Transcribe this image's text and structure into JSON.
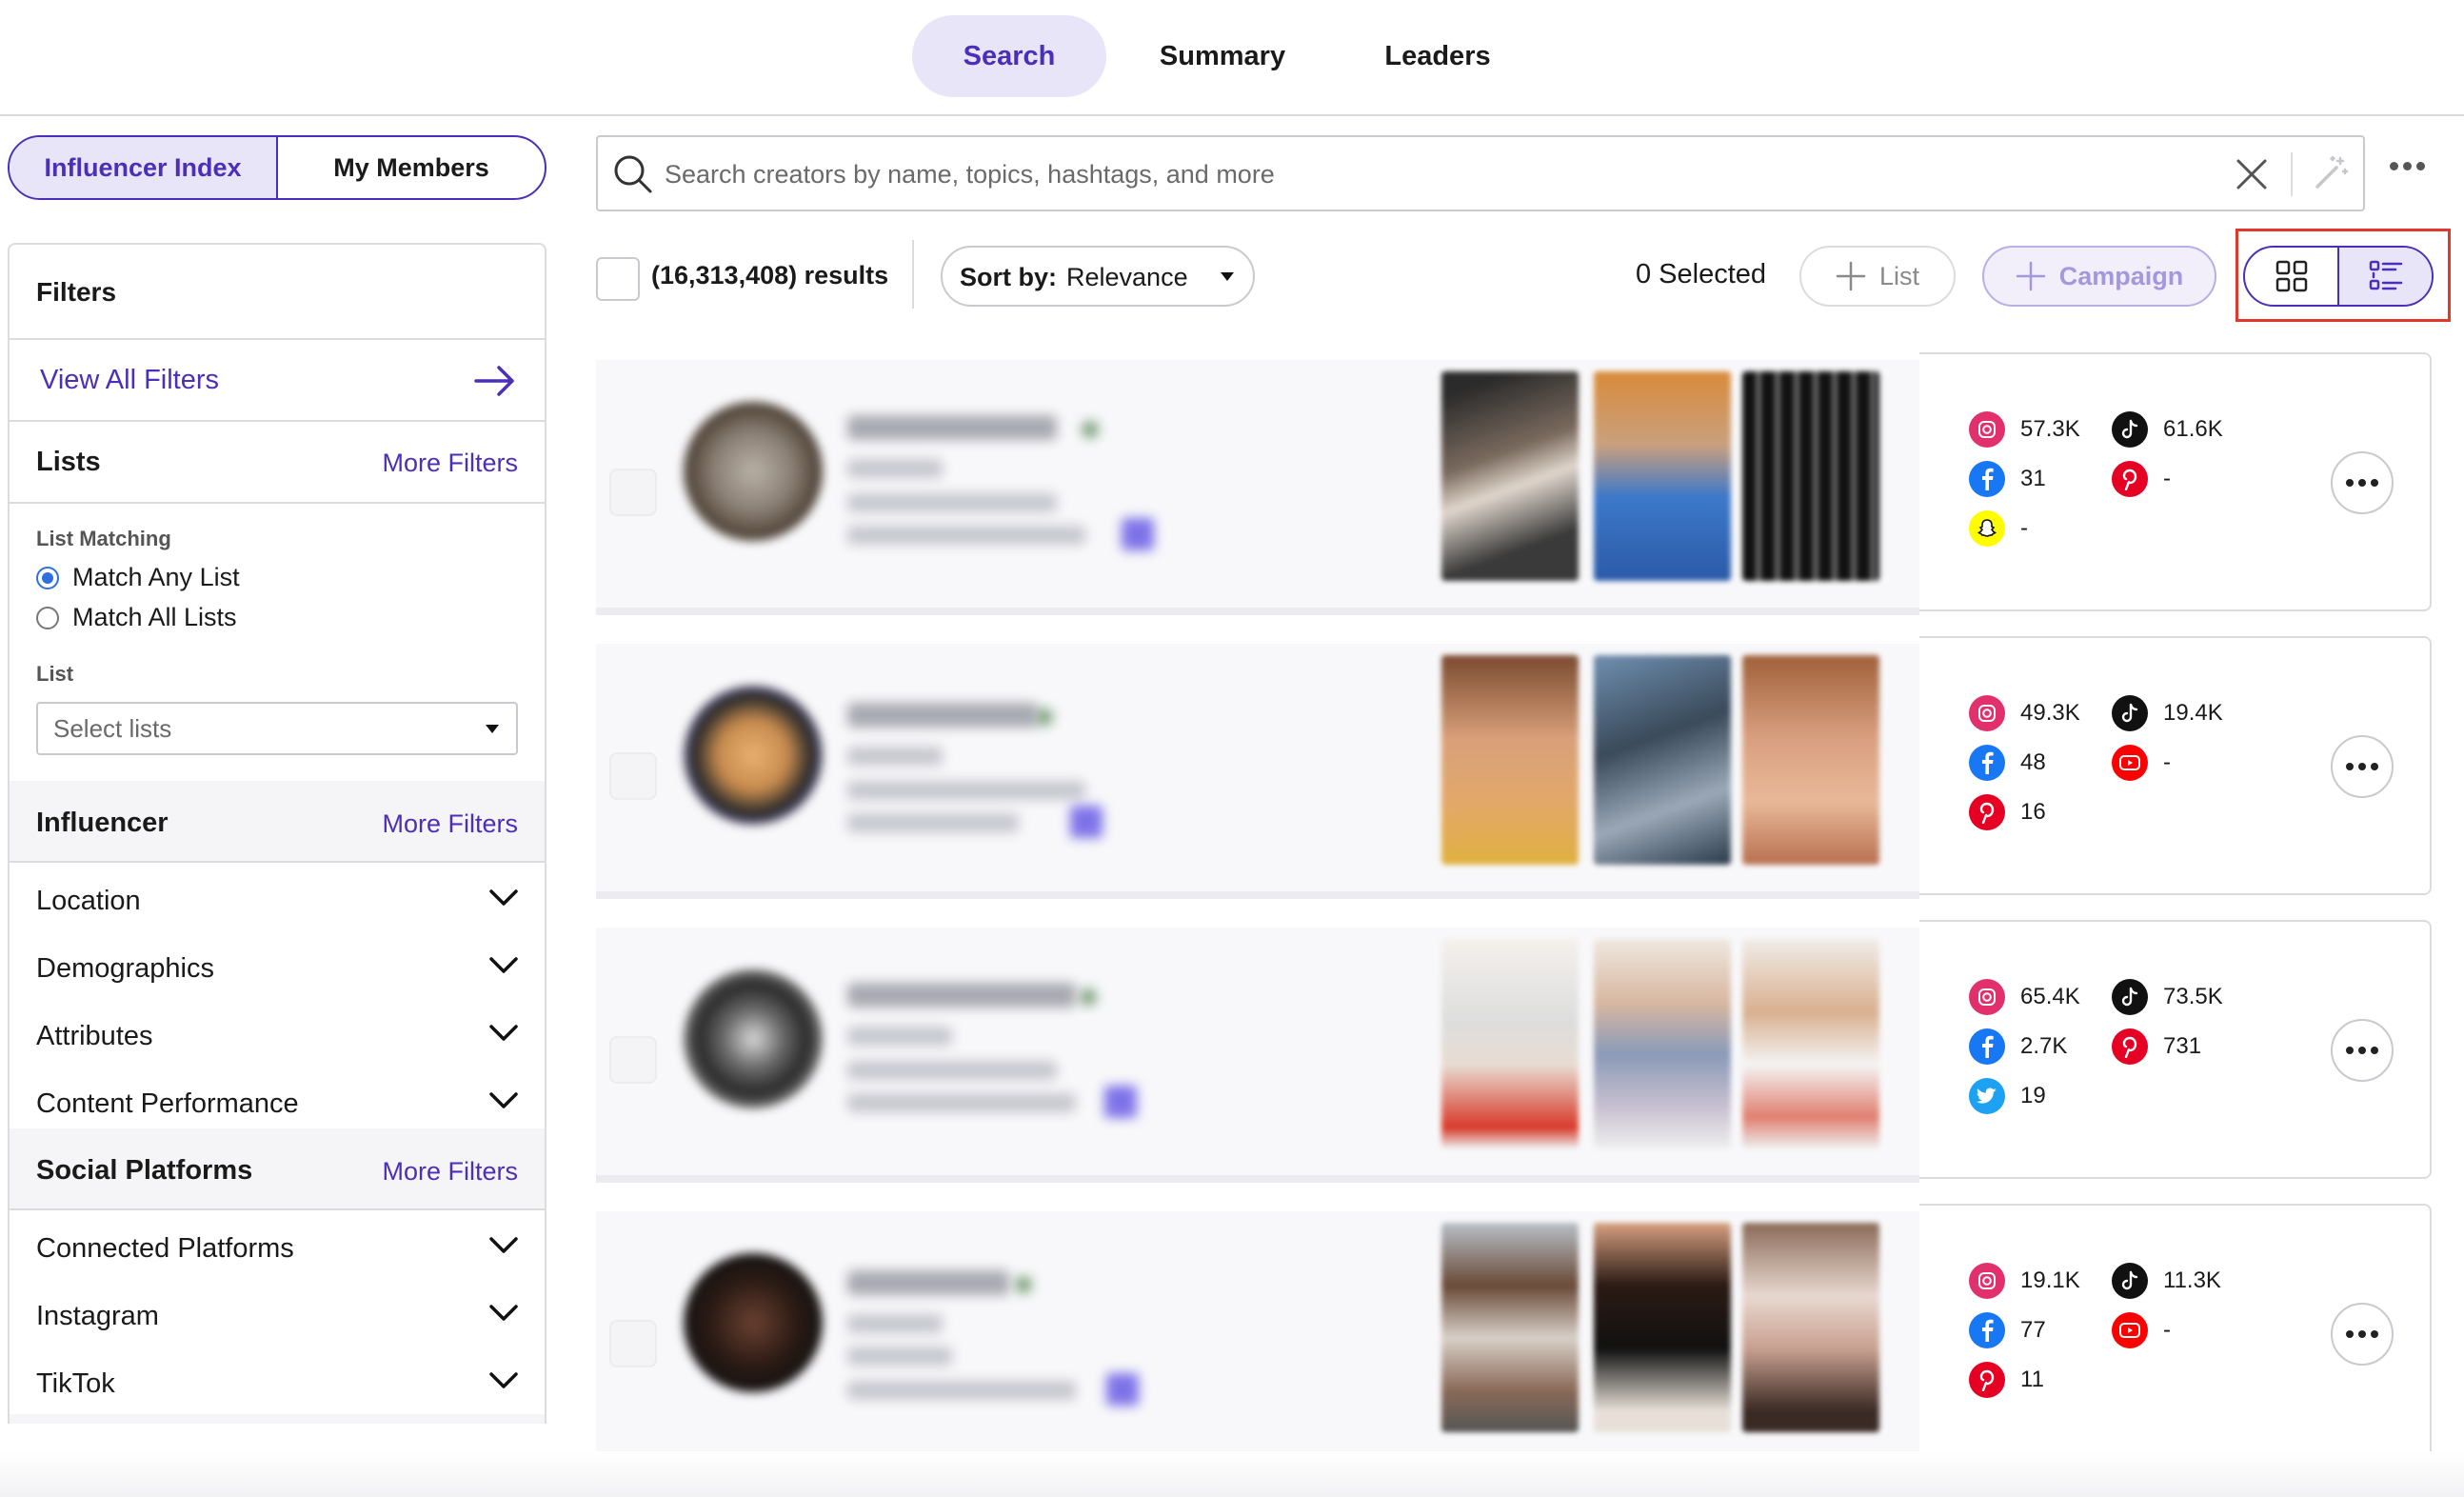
{
  "nav": {
    "tabs": [
      {
        "label": "Search"
      },
      {
        "label": "Summary"
      },
      {
        "label": "Leaders"
      }
    ]
  },
  "segment": {
    "index": "Influencer Index",
    "members": "My Members"
  },
  "filters": {
    "title": "Filters",
    "view_all": "View All Filters",
    "lists": {
      "title": "Lists",
      "more": "More Filters",
      "matching_label": "List Matching",
      "match_any": "Match Any List",
      "match_all": "Match All Lists",
      "list_label": "List",
      "select_placeholder": "Select lists"
    },
    "influencer": {
      "title": "Influencer",
      "more": "More Filters",
      "items": [
        "Location",
        "Demographics",
        "Attributes",
        "Content Performance"
      ]
    },
    "social": {
      "title": "Social Platforms",
      "more": "More Filters",
      "items": [
        "Connected Platforms",
        "Instagram",
        "TikTok"
      ]
    }
  },
  "search": {
    "placeholder": "Search creators by name, topics, hashtags, and more"
  },
  "toolbar": {
    "results": "(16,313,408) results",
    "sort_label": "Sort by:",
    "sort_value": "Relevance",
    "selected": "0 Selected",
    "list_btn": "List",
    "campaign_btn": "Campaign"
  },
  "cards": [
    {
      "stats": [
        {
          "icon": "instagram-icon",
          "value": "57.3K"
        },
        {
          "icon": "tiktok-icon",
          "value": "61.6K"
        },
        {
          "icon": "facebook-icon",
          "value": "31"
        },
        {
          "icon": "pinterest-icon",
          "value": "-"
        },
        {
          "icon": "snapchat-icon",
          "value": "-"
        }
      ]
    },
    {
      "stats": [
        {
          "icon": "instagram-icon",
          "value": "49.3K"
        },
        {
          "icon": "tiktok-icon",
          "value": "19.4K"
        },
        {
          "icon": "facebook-icon",
          "value": "48"
        },
        {
          "icon": "youtube-icon",
          "value": "-"
        },
        {
          "icon": "pinterest-icon",
          "value": "16"
        }
      ]
    },
    {
      "stats": [
        {
          "icon": "instagram-icon",
          "value": "65.4K"
        },
        {
          "icon": "tiktok-icon",
          "value": "73.5K"
        },
        {
          "icon": "facebook-icon",
          "value": "2.7K"
        },
        {
          "icon": "pinterest-icon",
          "value": "731"
        },
        {
          "icon": "twitter-icon",
          "value": "19"
        }
      ]
    },
    {
      "stats": [
        {
          "icon": "instagram-icon",
          "value": "19.1K"
        },
        {
          "icon": "tiktok-icon",
          "value": "11.3K"
        },
        {
          "icon": "facebook-icon",
          "value": "77"
        },
        {
          "icon": "youtube-icon",
          "value": "-"
        },
        {
          "icon": "pinterest-icon",
          "value": "11"
        }
      ]
    }
  ],
  "colors": {
    "accent": "#4b2fb8",
    "accent_bg": "#e9e5f8",
    "highlight_box": "#e0392b"
  }
}
